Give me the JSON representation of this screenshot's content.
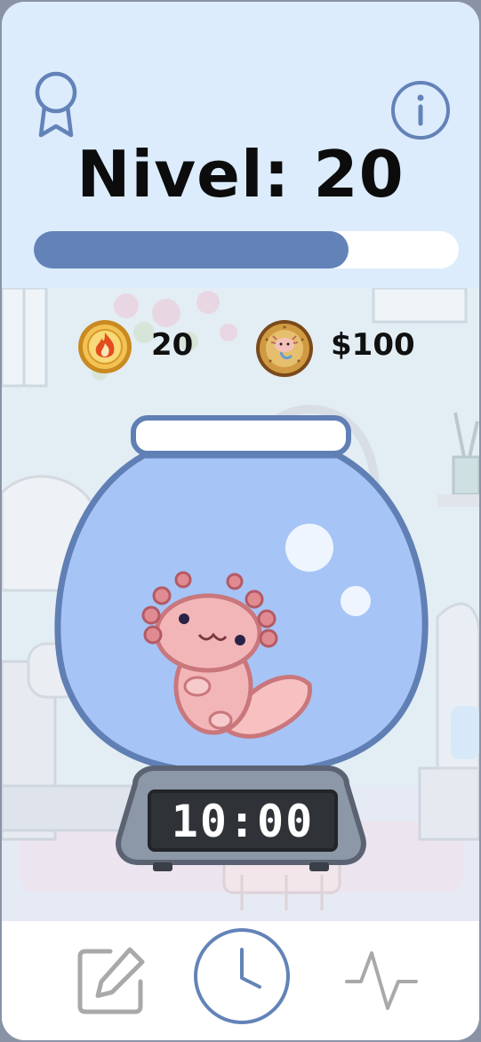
{
  "header": {
    "level_label": "Nivel: 20",
    "progress_fraction": 0.74,
    "icons": {
      "left": "award-icon",
      "right": "info-icon"
    }
  },
  "stats": {
    "streak_value": "20",
    "money_value": "$100",
    "streak_icon": "fire-coin-icon",
    "money_icon": "axolotl-coin-icon"
  },
  "timer": {
    "display": "10:00"
  },
  "nav": {
    "items": [
      {
        "icon": "edit-icon",
        "active": false
      },
      {
        "icon": "clock-icon",
        "active": true
      },
      {
        "icon": "activity-icon",
        "active": false
      }
    ]
  },
  "colors": {
    "header_bg": "#dcecfd",
    "accent": "#6383b8",
    "bowl_water": "#a6c4f6",
    "axolotl": "#f3b6b8",
    "inactive_icon": "#a9a9a9"
  }
}
